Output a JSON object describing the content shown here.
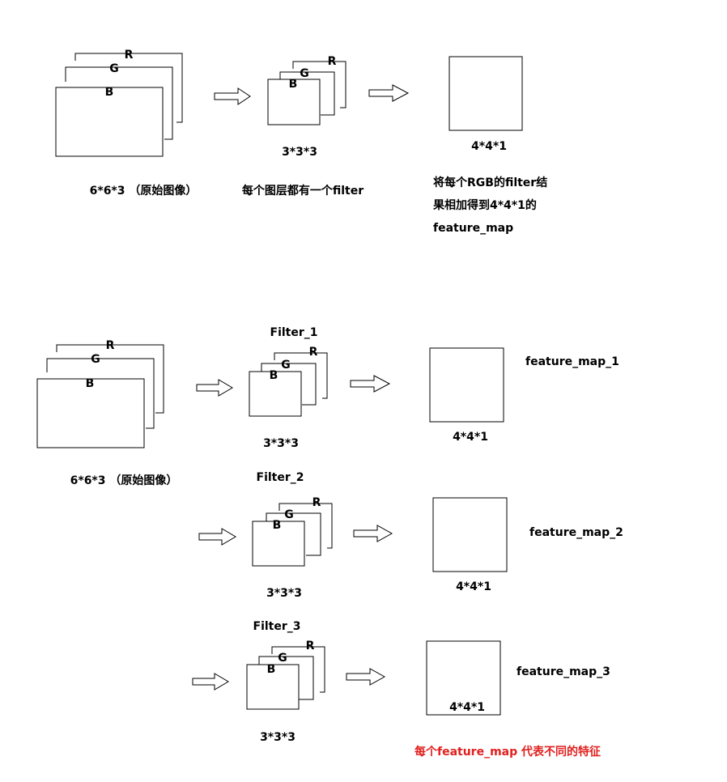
{
  "colors": {
    "note": "#e0201e",
    "line": "#000000",
    "background": "#ffffff"
  },
  "channels": {
    "r": "R",
    "g": "G",
    "b": "B"
  },
  "top": {
    "image_label": "6*6*3 （原始图像）",
    "filter_size": "3*3*3",
    "filter_desc": "每个图层都有一个filter",
    "output_size": "4*4*1",
    "explanation": [
      "将每个RGB的filter结",
      "果相加得到4*4*1的",
      "feature_map"
    ]
  },
  "bottom": {
    "image_label": "6*6*3 （原始图像）",
    "rows": [
      {
        "filter_name": "Filter_1",
        "filter_size": "3*3*3",
        "output_size": "4*4*1",
        "map_name": "feature_map_1"
      },
      {
        "filter_name": "Filter_2",
        "filter_size": "3*3*3",
        "output_size": "4*4*1",
        "map_name": "feature_map_2"
      },
      {
        "filter_name": "Filter_3",
        "filter_size": "3*3*3",
        "output_size": "4*4*1",
        "map_name": "feature_map_3"
      }
    ],
    "conclusion": "每个feature_map 代表不同的特征"
  }
}
